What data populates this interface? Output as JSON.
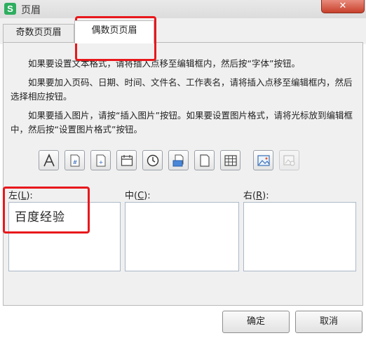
{
  "window": {
    "title": "页眉",
    "app_icon_letter": "S",
    "close_symbol": "✕"
  },
  "tabs": [
    {
      "label": "奇数页页眉",
      "active": false
    },
    {
      "label": "偶数页页眉",
      "active": true
    }
  ],
  "instructions": [
    "如果要设置文本格式，请将插入点移至编辑框内，然后按“字体”按钮。",
    "如果要加入页码、日期、时间、文件名、工作表名，请将插入点移至编辑框内，然后选择相应按钮。",
    "如果要插入图片，请按“插入图片”按钮。如果要设置图片格式，请将光标放到编辑框中，然后按“设置图片格式”按钮。"
  ],
  "toolbar": [
    {
      "icon": "font-icon",
      "enabled": true
    },
    {
      "icon": "page-number-icon",
      "enabled": true
    },
    {
      "icon": "total-pages-icon",
      "enabled": true
    },
    {
      "icon": "date-icon",
      "enabled": true
    },
    {
      "icon": "time-icon",
      "enabled": true
    },
    {
      "icon": "file-path-icon",
      "enabled": true
    },
    {
      "icon": "file-name-icon",
      "enabled": true
    },
    {
      "icon": "sheet-name-icon",
      "enabled": true
    },
    {
      "icon": "insert-picture-icon",
      "enabled": true
    },
    {
      "icon": "format-picture-icon",
      "enabled": false
    }
  ],
  "sections": {
    "left": {
      "label_prefix": "左(",
      "accesskey": "L",
      "label_suffix": "):",
      "content": "百度经验"
    },
    "center": {
      "label_prefix": "中(",
      "accesskey": "C",
      "label_suffix": "):",
      "content": ""
    },
    "right": {
      "label_prefix": "右(",
      "accesskey": "R",
      "label_suffix": "):",
      "content": ""
    }
  },
  "buttons": {
    "ok": "确定",
    "cancel": "取消"
  },
  "colors": {
    "highlight": "#e8181c",
    "app_icon": "#2eae5f",
    "close": "#c8412c"
  }
}
